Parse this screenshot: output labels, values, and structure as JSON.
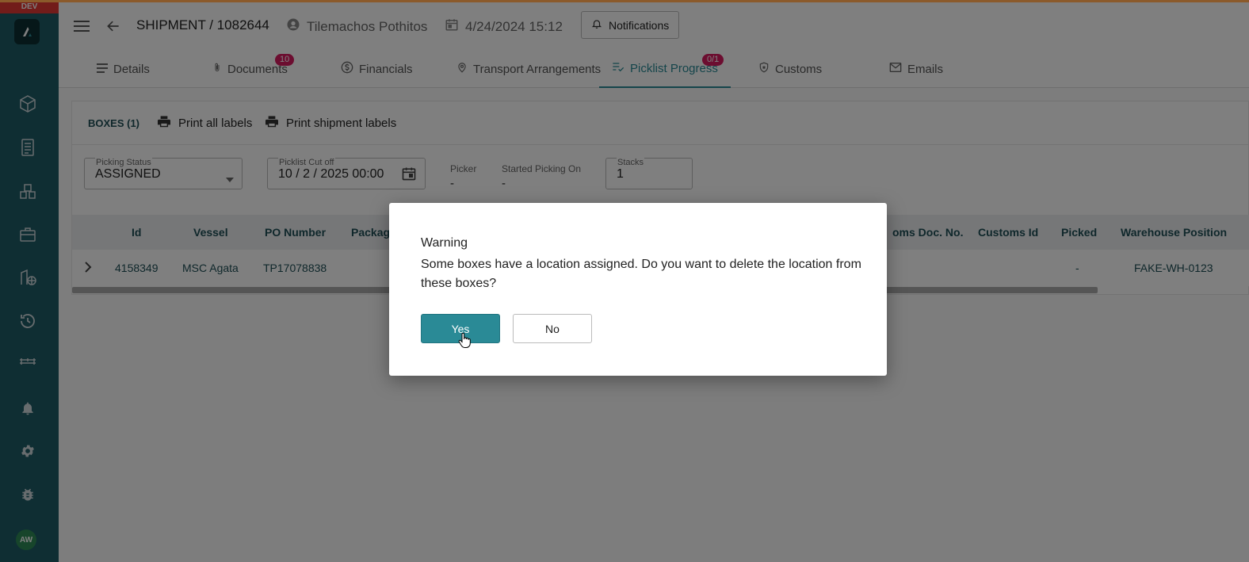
{
  "env_badge": "DEV",
  "user_initials": "AW",
  "header": {
    "title": "SHIPMENT / 1082644",
    "user": "Tilemachos Pothitos",
    "datetime": "4/24/2024 15:12",
    "notifications_label": "Notifications"
  },
  "tabs": [
    {
      "label": "Details",
      "icon": "list-icon"
    },
    {
      "label": "Documents",
      "icon": "paperclip-icon",
      "badge": "10"
    },
    {
      "label": "Financials",
      "icon": "dollar-icon"
    },
    {
      "label": "Transport Arrangements",
      "icon": "location-pin-icon"
    },
    {
      "label": "Picklist Progress",
      "icon": "checklist-icon",
      "badge": "0/1",
      "active": true
    },
    {
      "label": "Customs",
      "icon": "shield-icon"
    },
    {
      "label": "Emails",
      "icon": "mail-icon"
    }
  ],
  "toolbar": {
    "boxes_label": "BOXES (1)",
    "print_all": "Print all labels",
    "print_shipment": "Print shipment labels"
  },
  "fields": {
    "picking_status_label": "Picking Status",
    "picking_status_value": "ASSIGNED",
    "cutoff_label": "Picklist Cut off",
    "cutoff_value": "10 / 2 / 2025 00:00",
    "picker_label": "Picker",
    "picker_value": "-",
    "started_label": "Started Picking On",
    "started_value": "-",
    "stacks_label": "Stacks",
    "stacks_value": "1"
  },
  "table": {
    "columns": [
      "Id",
      "Vessel",
      "PO Number",
      "Packag",
      "oms Doc. No.",
      "Customs Id",
      "Picked",
      "Warehouse Position"
    ],
    "rows": [
      {
        "id": "4158349",
        "vessel": "MSC Agata",
        "po_number": "TP17078838",
        "picked": "-",
        "warehouse_position": "FAKE-WH-0123"
      }
    ]
  },
  "dialog": {
    "title": "Warning",
    "message": "Some boxes have a location assigned. Do you want to delete the location from these boxes?",
    "yes_label": "Yes",
    "no_label": "No"
  },
  "colors": {
    "sidebar": "#1f5d67",
    "accent": "#2a8a96",
    "badge": "#d81b60"
  }
}
